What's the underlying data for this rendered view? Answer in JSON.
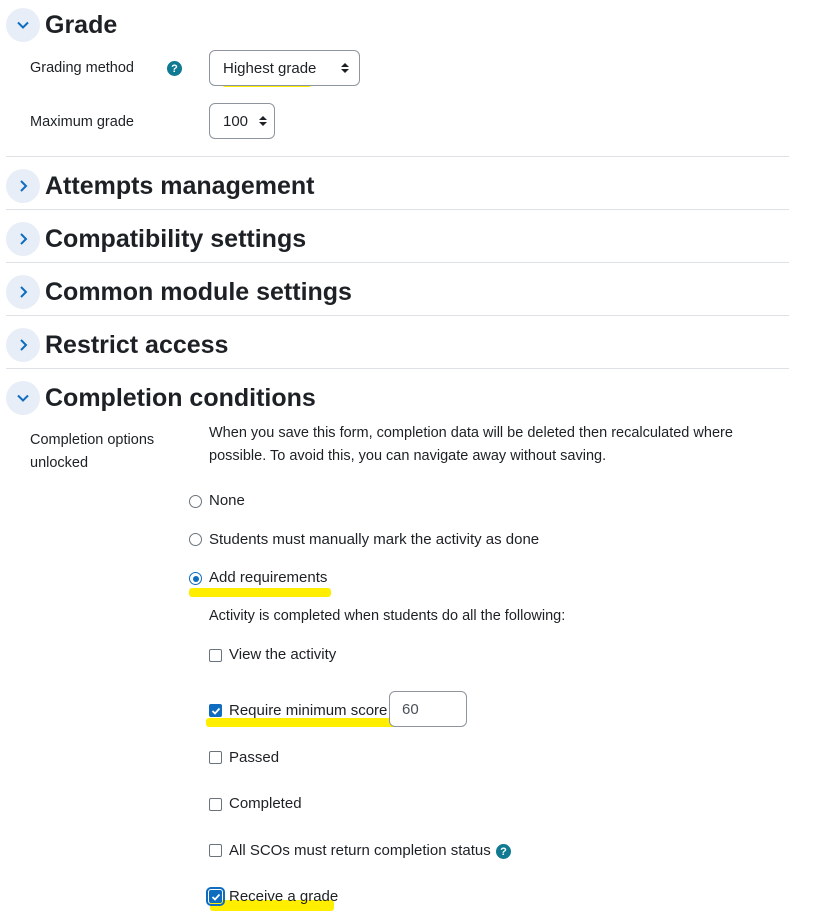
{
  "sections": {
    "grade": {
      "title": "Grade",
      "expanded": true
    },
    "attempts": {
      "title": "Attempts management",
      "expanded": false
    },
    "compatibility": {
      "title": "Compatibility settings",
      "expanded": false
    },
    "common": {
      "title": "Common module settings",
      "expanded": false
    },
    "restrict": {
      "title": "Restrict access",
      "expanded": false
    },
    "completion": {
      "title": "Completion conditions",
      "expanded": true
    }
  },
  "grade": {
    "grading_method_label": "Grading method",
    "grading_method_value": "Highest grade",
    "maximum_grade_label": "Maximum grade",
    "maximum_grade_value": "100"
  },
  "completion": {
    "options_label_line1": "Completion options",
    "options_label_line2": "unlocked",
    "notice_line1": "When you save this form, completion data will be deleted then recalculated where",
    "notice_line2": "possible. To avoid this, you can navigate away without saving.",
    "radio_none": "None",
    "radio_manual": "Students must manually mark the activity as done",
    "radio_add": "Add requirements",
    "selected_radio": "Add requirements",
    "requirements_intro": "Activity is completed when students do all the following:",
    "cb_view": {
      "label": "View the activity",
      "checked": false
    },
    "cb_min_score": {
      "label": "Require minimum score",
      "checked": true,
      "value": "60"
    },
    "cb_passed": {
      "label": "Passed",
      "checked": false
    },
    "cb_completed": {
      "label": "Completed",
      "checked": false
    },
    "cb_scos": {
      "label": "All SCOs must return completion status",
      "checked": false
    },
    "cb_receive_grade": {
      "label": "Receive a grade",
      "checked": true
    }
  },
  "icons": {
    "help": "?",
    "expanded": "chevron-down-icon",
    "collapsed": "chevron-right-icon"
  },
  "colors": {
    "accent": "#0f6cbf",
    "highlight": "#ffee00",
    "help_badge": "#0f7a91"
  }
}
